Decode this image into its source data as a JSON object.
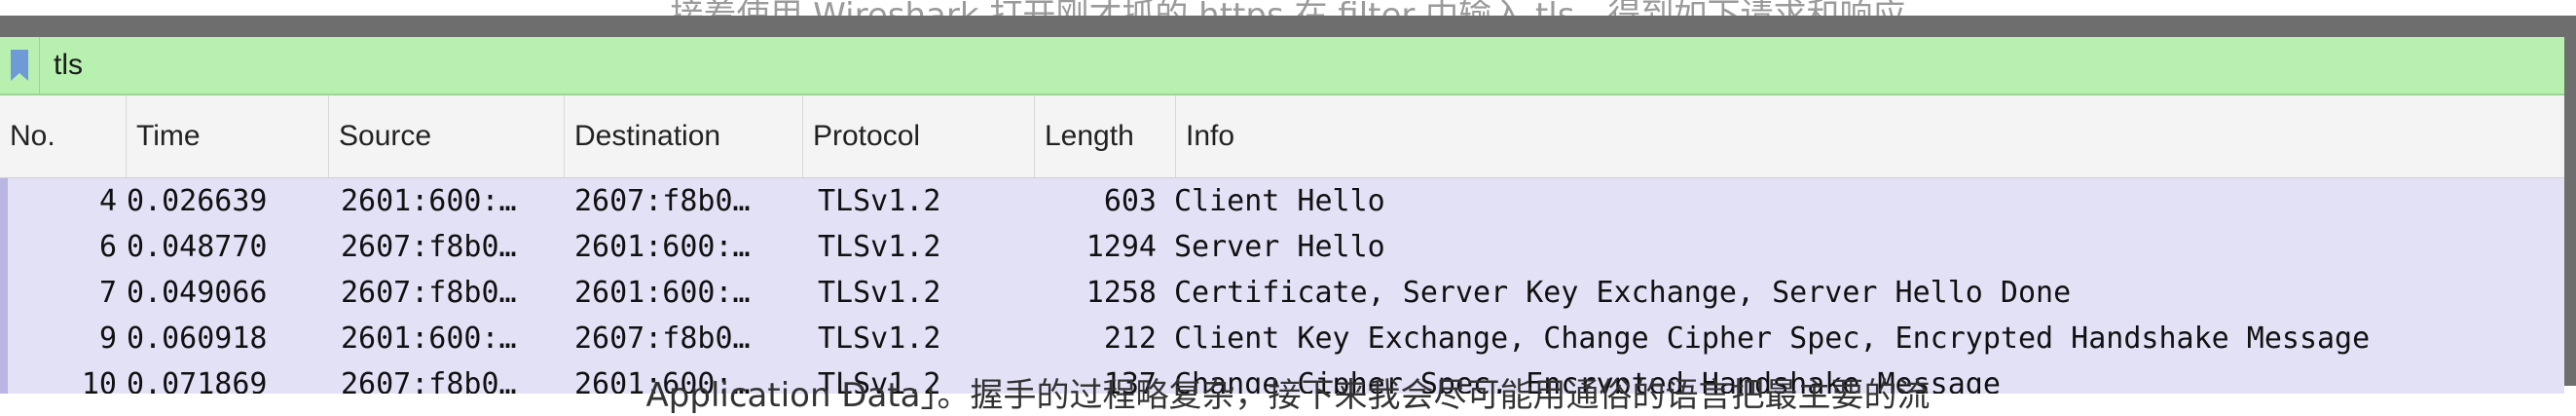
{
  "background_text": {
    "top": "接着使用 Wireshark 打开刚才抓的 https     在 filter 中输入 tls，得到如下请求和响应",
    "bottom": "Application Data」。握手的过程略复杂，接下来我会尽可能用通俗的语言把最主要的流"
  },
  "filter": {
    "value": "tls",
    "bar_color": "#b8f0b0"
  },
  "columns": {
    "no": "No.",
    "time": "Time",
    "source": "Source",
    "destination": "Destination",
    "protocol": "Protocol",
    "length": "Length",
    "info": "Info"
  },
  "packets": [
    {
      "no": "4",
      "time": "0.026639",
      "source": "2601:600:…",
      "destination": "2607:f8b0…",
      "protocol": "TLSv1.2",
      "length": "603",
      "info": "Client Hello"
    },
    {
      "no": "6",
      "time": "0.048770",
      "source": "2607:f8b0…",
      "destination": "2601:600:…",
      "protocol": "TLSv1.2",
      "length": "1294",
      "info": "Server Hello"
    },
    {
      "no": "7",
      "time": "0.049066",
      "source": "2607:f8b0…",
      "destination": "2601:600:…",
      "protocol": "TLSv1.2",
      "length": "1258",
      "info": "Certificate, Server Key Exchange, Server Hello Done"
    },
    {
      "no": "9",
      "time": "0.060918",
      "source": "2601:600:…",
      "destination": "2607:f8b0…",
      "protocol": "TLSv1.2",
      "length": "212",
      "info": "Client Key Exchange, Change Cipher Spec, Encrypted Handshake Message"
    },
    {
      "no": "10",
      "time": "0.071869",
      "source": "2607:f8b0…",
      "destination": "2601:600:…",
      "protocol": "TLSv1.2",
      "length": "137",
      "info": "Change Cipher Spec, Encrypted Handshake Message"
    }
  ],
  "colors": {
    "row_background": "#e3e1f6",
    "header_background": "#f4f4f4",
    "bookmark_icon": "#6f9ad6"
  },
  "icons": {
    "bookmark": "bookmark-icon"
  }
}
